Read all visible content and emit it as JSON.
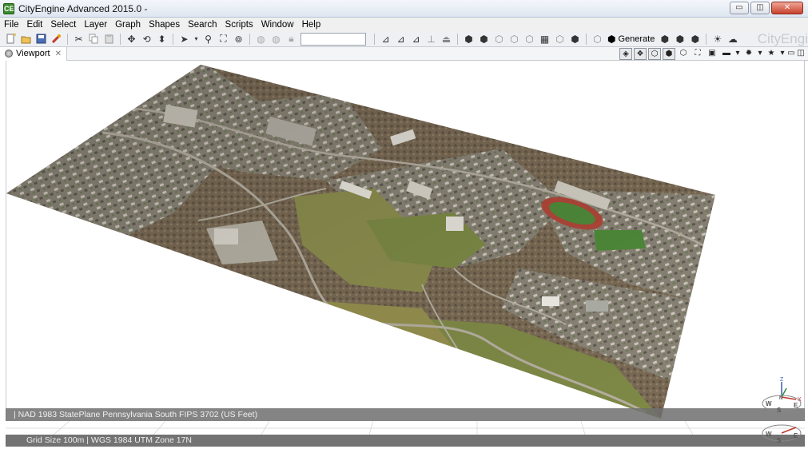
{
  "window": {
    "title": "CityEngine Advanced 2015.0 -",
    "app_icon": "CE",
    "minimize_glyph": "▭",
    "maximize_glyph": "◫",
    "close_glyph": "✕"
  },
  "menu": [
    "File",
    "Edit",
    "Select",
    "Layer",
    "Graph",
    "Shapes",
    "Search",
    "Scripts",
    "Window",
    "Help"
  ],
  "toolbar": {
    "search_value": "",
    "generate_label": "Generate",
    "brand_text": "CityEngi"
  },
  "tabs": [
    {
      "label": "Viewport",
      "close": "✕"
    }
  ],
  "viewport": {
    "status_top": "|  NAD 1983 StatePlane Pennsylvania South FIPS 3702 (US Feet)",
    "status_bottom": "Grid Size 100m  |  WGS 1984 UTM Zone 17N",
    "compass_letters": {
      "n": "N",
      "e": "E",
      "s": "S",
      "w": "W",
      "z": "Z",
      "x": "X"
    }
  },
  "colors": {
    "terrain_grass": "#8c8e4e",
    "terrain_urban": "#8a8477",
    "track": "#b0473a",
    "field": "#4f8b3a",
    "status_bar": "#6e6e6e"
  }
}
